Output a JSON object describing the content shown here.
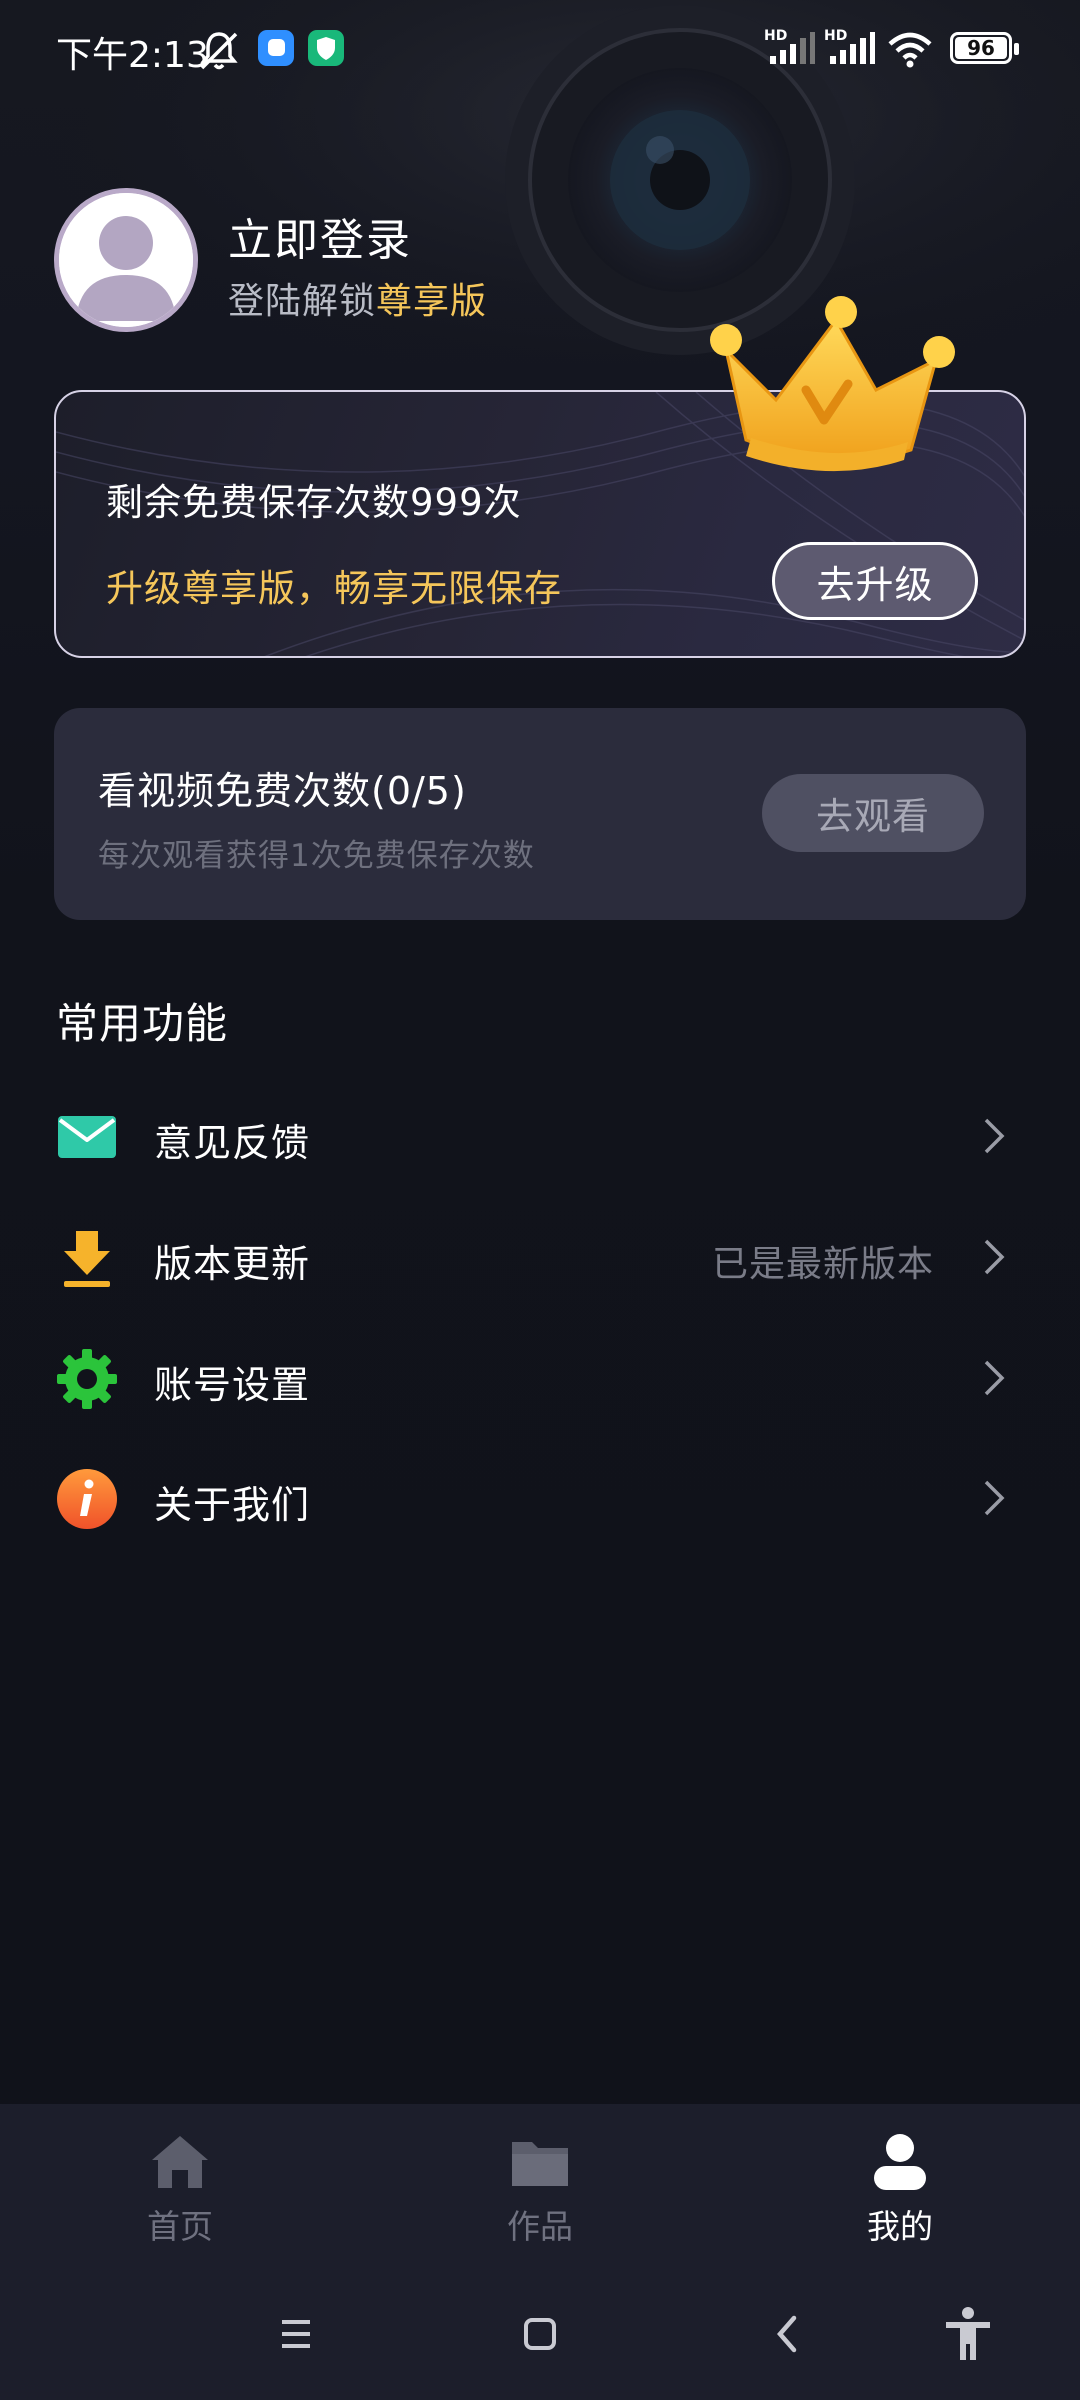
{
  "status_bar": {
    "time": "下午2:13",
    "network_1": "HD",
    "network_2": "HD",
    "battery": "96"
  },
  "profile": {
    "login_title": "立即登录",
    "login_sub_prefix": "登陆解锁",
    "login_sub_vip": "尊享版"
  },
  "vip_card": {
    "remaining": "剩余免费保存次数999次",
    "promo": "升级尊享版，畅享无限保存",
    "upgrade_label": "去升级"
  },
  "video_card": {
    "title": "看视频免费次数(0/5)",
    "subtitle": "每次观看获得1次免费保存次数",
    "watch_label": "去观看"
  },
  "common": {
    "title": "常用功能",
    "items": [
      {
        "label": "意见反馈",
        "icon": "mail-icon",
        "extra": ""
      },
      {
        "label": "版本更新",
        "icon": "download-icon",
        "extra": "已是最新版本"
      },
      {
        "label": "账号设置",
        "icon": "gear-icon",
        "extra": ""
      },
      {
        "label": "关于我们",
        "icon": "info-icon",
        "extra": ""
      }
    ]
  },
  "bottom_nav": {
    "items": [
      {
        "label": "首页",
        "icon": "home-icon",
        "active": false
      },
      {
        "label": "作品",
        "icon": "folder-icon",
        "active": false
      },
      {
        "label": "我的",
        "icon": "user-icon",
        "active": true
      }
    ]
  },
  "colors": {
    "background": "#11131b",
    "vip_gold": "#f5c65a",
    "card": "#2b2c3c",
    "nav_bg": "#1c1e2b"
  }
}
